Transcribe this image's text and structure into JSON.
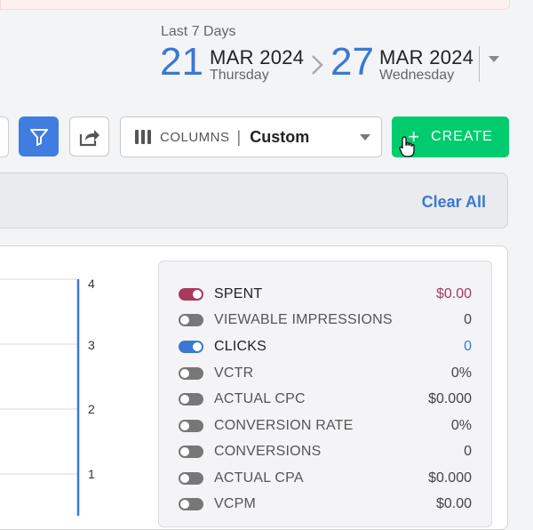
{
  "date_range": {
    "label": "Last 7 Days",
    "start": {
      "day": "21",
      "month_year": "MAR 2024",
      "weekday": "Thursday"
    },
    "end": {
      "day": "27",
      "month_year": "MAR 2024",
      "weekday": "Wednesday"
    }
  },
  "toolbar": {
    "columns_label": "COLUMNS",
    "columns_divider": "|",
    "columns_value": "Custom",
    "create_plus": "+",
    "create_label": "CREATE"
  },
  "filter_bar": {
    "clear_all": "Clear All"
  },
  "chart": {
    "y_ticks": [
      "4",
      "3",
      "2",
      "1"
    ]
  },
  "metrics": [
    {
      "name": "SPENT",
      "value": "$0.00",
      "enabled": true,
      "color": "#a83a5e"
    },
    {
      "name": "VIEWABLE IMPRESSIONS",
      "value": "0",
      "enabled": false,
      "color": "#444444"
    },
    {
      "name": "CLICKS",
      "value": "0",
      "enabled": true,
      "color": "#3a78d4"
    },
    {
      "name": "VCTR",
      "value": "0%",
      "enabled": false,
      "color": "#444444"
    },
    {
      "name": "ACTUAL CPC",
      "value": "$0.000",
      "enabled": false,
      "color": "#444444"
    },
    {
      "name": "CONVERSION RATE",
      "value": "0%",
      "enabled": false,
      "color": "#444444"
    },
    {
      "name": "CONVERSIONS",
      "value": "0",
      "enabled": false,
      "color": "#444444"
    },
    {
      "name": "ACTUAL CPA",
      "value": "$0.000",
      "enabled": false,
      "color": "#444444"
    },
    {
      "name": "VCPM",
      "value": "$0.00",
      "enabled": false,
      "color": "#444444"
    }
  ],
  "colors": {
    "accent": "#3f7de0",
    "create": "#00cc6e",
    "spent": "#a83a5e",
    "clicks": "#3a78d4"
  }
}
